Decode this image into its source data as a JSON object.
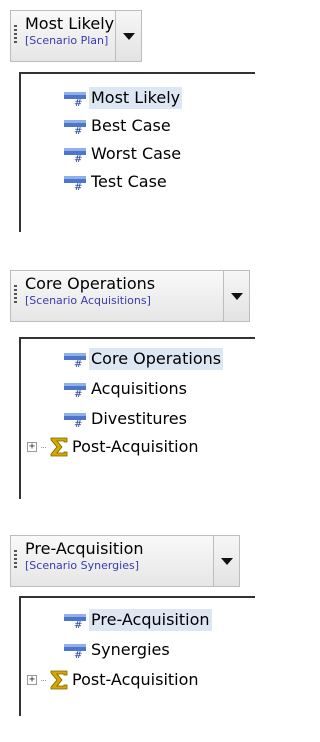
{
  "groups": [
    {
      "dropdown": {
        "title": "Most Likely",
        "subtitle": "[Scenario Plan]"
      },
      "items": [
        {
          "label": "Most Likely",
          "selected": true,
          "icon": "scenario-icon"
        },
        {
          "label": "Best Case",
          "selected": false,
          "icon": "scenario-icon"
        },
        {
          "label": "Worst Case",
          "selected": false,
          "icon": "scenario-icon"
        },
        {
          "label": "Test Case",
          "selected": false,
          "icon": "scenario-icon"
        }
      ]
    },
    {
      "dropdown": {
        "title": "Core Operations",
        "subtitle": "[Scenario Acquisitions]"
      },
      "items": [
        {
          "label": "Core Operations",
          "selected": true,
          "icon": "scenario-icon"
        },
        {
          "label": "Acquisitions",
          "selected": false,
          "icon": "scenario-icon"
        },
        {
          "label": "Divestitures",
          "selected": false,
          "icon": "scenario-icon"
        },
        {
          "label": "Post-Acquisition",
          "selected": false,
          "icon": "sigma-icon",
          "expandable": true
        }
      ]
    },
    {
      "dropdown": {
        "title": "Pre-Acquisition",
        "subtitle": "[Scenario Synergies]"
      },
      "items": [
        {
          "label": "Pre-Acquisition",
          "selected": true,
          "icon": "scenario-icon"
        },
        {
          "label": "Synergies",
          "selected": false,
          "icon": "scenario-icon"
        },
        {
          "label": "Post-Acquisition",
          "selected": false,
          "icon": "sigma-icon",
          "expandable": true
        }
      ]
    }
  ],
  "colors": {
    "selection": "#dde6f3",
    "subtitle": "#3a3ab0",
    "sigma": "#d4a800"
  }
}
